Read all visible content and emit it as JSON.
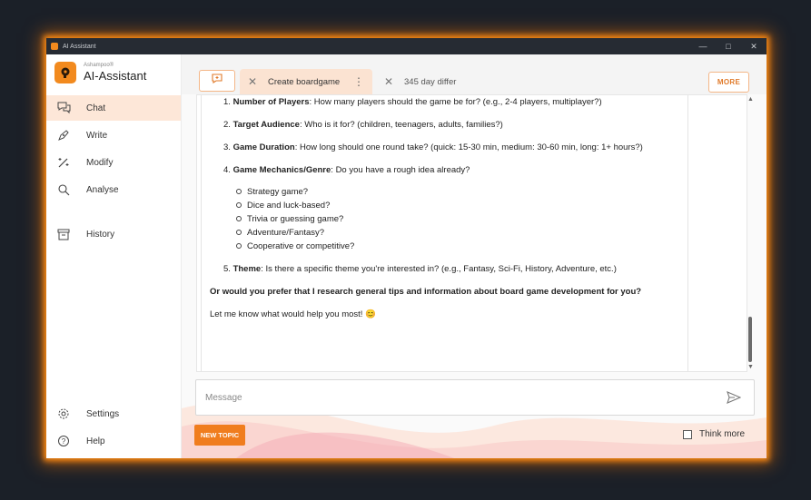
{
  "window": {
    "title": "AI Assistant",
    "controls": {
      "minimize": "—",
      "maximize": "□",
      "close": "✕"
    }
  },
  "brand": {
    "company": "Ashampoo®",
    "product": "AI-Assistant"
  },
  "sidebar": {
    "items": [
      {
        "label": "Chat",
        "icon": "chat-bubbles-icon",
        "active": true
      },
      {
        "label": "Write",
        "icon": "pen-icon"
      },
      {
        "label": "Modify",
        "icon": "magic-wand-icon"
      },
      {
        "label": "Analyse",
        "icon": "search-icon"
      },
      {
        "label": "History",
        "icon": "archive-box-icon"
      }
    ],
    "bottom": [
      {
        "label": "Settings",
        "icon": "gear-icon"
      },
      {
        "label": "Help",
        "icon": "help-circle-icon"
      }
    ]
  },
  "tabs": [
    {
      "label": "Create boardgame",
      "active": true
    },
    {
      "label": "345 day differ",
      "active": false
    }
  ],
  "more_button": "MORE",
  "message": {
    "numbered": [
      {
        "num": "1.",
        "bold": "Number of Players",
        "text": ": How many players should the game be for? (e.g., 2-4 players, multiplayer?)"
      },
      {
        "num": "2.",
        "bold": "Target Audience",
        "text": ": Who is it for? (children, teenagers, adults, families?)"
      },
      {
        "num": "3.",
        "bold": "Game Duration",
        "text": ": How long should one round take? (quick: 15-30 min, medium: 30-60 min, long: 1+ hours?)"
      },
      {
        "num": "4.",
        "bold": "Game Mechanics/Genre",
        "text": ": Do you have a rough idea already?"
      },
      {
        "num": "5.",
        "bold": "Theme",
        "text": ": Is there a specific theme you're interested in? (e.g., Fantasy, Sci-Fi, History, Adventure, etc.)"
      }
    ],
    "bullets": [
      "Strategy game?",
      "Dice and luck-based?",
      "Trivia or guessing game?",
      "Adventure/Fantasy?",
      "Cooperative or competitive?"
    ],
    "question": "Or would you prefer that I research general tips and information about board game development for you?",
    "closing": "Let me know what would help you most! 😊"
  },
  "input": {
    "placeholder": "Message",
    "value": ""
  },
  "new_topic": "NEW TOPIC",
  "think_more": {
    "label": "Think more",
    "checked": false
  },
  "colors": {
    "accent": "#f07d1e",
    "active_bg": "#fde7d8",
    "titlebar": "#262b33"
  }
}
